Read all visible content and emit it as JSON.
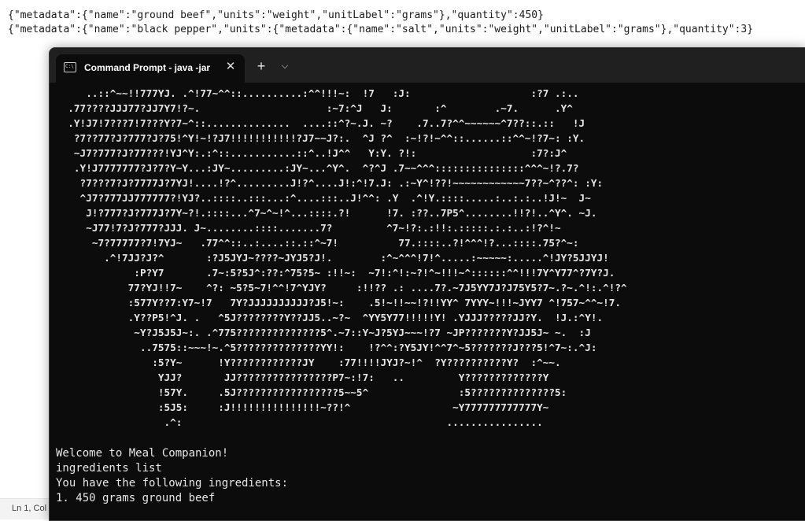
{
  "editor": {
    "line1": "{\"metadata\":{\"name\":\"ground beef\",\"units\":\"weight\",\"unitLabel\":\"grams\"},\"quantity\":450}",
    "line2": "{\"metadata\":{\"name\":\"black pepper\",\"units\":{\"metadata\":{\"name\":\"salt\",\"units\":\"weight\",\"unitLabel\":\"grams\"},\"quantity\":3}",
    "status": "Ln 1, Col"
  },
  "terminal": {
    "tab_icon_text": "C:\\",
    "tab_title": "Command Prompt - java  -jar",
    "close_glyph": "✕",
    "new_tab_glyph": "+",
    "dropdown_glyph": "⌵",
    "ascii_art": "     ..::^~~!!777YJ. .^!77~^^::..........:^^!!!~:  !7   :J:                    :?7 .:..\n  .77????JJJ77?JJ7Y7!?~.                     :~7:^J   J:       :^        .~7.      .Y^\n  .Y!J7!7???7!7???Y?7~^::..............  ....::^?~.J. ~?    .7..7?^^~~~~~~^7??::.::   !J\n   ?7??77?J?777?J?75!^Y!~!?J7!!!!!!!!!!!?J7~~J?:.  ^J ?^  :~!?!~^^::......::^^~!?7~: :Y.\n   ~J7?777?J?77???!YJ^Y:.:^::...........::^..!J^^   Y:Y. ?!:                   :7?:J^\n   .Y!J7777777?J?7?Y~Y...:JY~.........:JY~...^Y^.  ^?^J .7~~^^^:::::::::::::::^^^~!?.7?\n    ?7???7?J?7777J?7YJ!....!?^.........J!?^....J!:^!7.J: .:~Y^!??!~~~~~~~~~~~~7??~^??^: :Y:\n    ^J7?777JJ777777?!YJ?..::::..:::...:^....:::..J!^^: .Y  .^!Y.::::.....:..:.:..!J!~  J~\n     J!?777?J?777J?7Y~?!.::::...^7~^~!^...::::.?!      !7. :??..7P5^........!!?!..^Y^. ~J.\n     ~J77!7?J?777?JJJ. J~........::::.......7?         ^7~!?:.:!!:.:::::.:.:..:!?^!~\n      ~7?77777?7!7YJ~   .77^^::..:....::.::^~7!          77.::::..?!^^^!?...::::.75?^~:\n        .^!7JJ?J?^       :?J5JYJ~????~JYJ5?J!.        :^~^^^!7!^.....:~~~~~:.....^!JY?5JJYJ!\n             :P?Y7       .7~:5?5J^:??:^75?5~ :!!~:  ~7!:^!:~?!^~!!!~^::::::^^!!!7Y^Y77^?7Y?J.\n            77?YJ!!7~    ^?: ~5?5~7!^^!7^YJY?     :!!?? .: ....7?.~7J5YY7J?J75Y5?7~.?~.^!:.^!?^\n            :577Y??7:Y7~!7   7Y?JJJJJJJJJJ?J5!~:    .5!~!!~~!?!!YY^ 7YYY~!!!~JYY7 ^!757~^^~!7.\n            .Y??P5!^J. .   ^5J????????Y??JJ5..~?~  ^YY5Y77!!!!!Y! .YJJJ?????JJ?Y.  !J.:^Y!.\n             ~Y?J5J5J~:. .^775??????????????5^.~7::Y~J?5YJ~~~!?7 ~JP???????Y?JJ5J~ ~.  :J\n              ..7575::~~~!~.^5??????????????YY!:    !?^^:?Y5JY!^^7^~5???????J???5!^7~:.^J:\n                :5?Y~      !Y????????????JY    :77!!!!JYJ?~!^  ?Y??????????Y?  :^~~.\n                 YJJ?       JJ????????????????P7~:!7:   ..         Y?????????????Y\n                 !57Y.     .5J?????????????????5~~5^               :5??????????????5:\n                 :5J5:     :J!!!!!!!!!!!!!!!~??!^                 ~Y777777777777Y~\n                  .^:                                            ................"
  },
  "console": {
    "welcome": "Welcome to Meal Companion!",
    "command": "ingredients list",
    "header": "You have the following ingredients:",
    "items": [
      "1. 450 grams ground beef"
    ]
  }
}
